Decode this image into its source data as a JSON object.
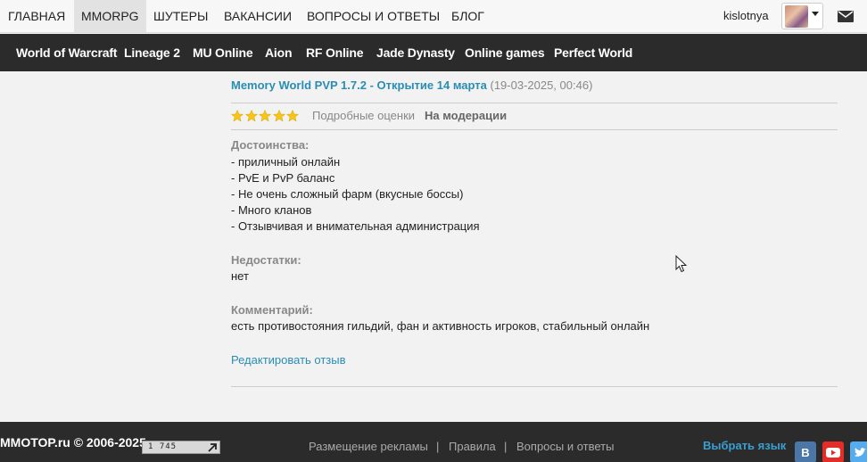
{
  "topnav": {
    "items": [
      "ГЛАВНАЯ",
      "MMORPG",
      "ШУТЕРЫ",
      "ВАКАНСИИ",
      "ВОПРОСЫ И ОТВЕТЫ",
      "БЛОГ"
    ],
    "active_index": 1,
    "username": "kislotnya",
    "avatar_icon": "user-avatar",
    "mail_icon": "envelope-icon"
  },
  "subnav": {
    "items": [
      "World of Warcraft",
      "Lineage 2",
      "MU Online",
      "Aion",
      "RF Online",
      "Jade Dynasty",
      "Online games",
      "Perfect World"
    ]
  },
  "review": {
    "title": "Memory World PVP 1.7.2 - Открытие 14 марта",
    "date": "(19-03-2025, 00:46)",
    "rating": 5,
    "rating_max": 5,
    "star_color": "#f5c518",
    "detailed_label": "Подробные оценки",
    "status_label": "На модерации",
    "pros_label": "Достоинства:",
    "pros": [
      "- приличный онлайн",
      "- PvE и PvP баланс",
      "- Не очень сложный фарм (вкусные боссы)",
      "- Много кланов",
      "- Отзывчивая и внимательная администрация"
    ],
    "cons_label": "Недостатки:",
    "cons": [
      "нет"
    ],
    "comment_label": "Комментарий:",
    "comment": [
      "есть противостояния гильдий, фан и активность игроков, стабильный онлайн"
    ],
    "edit_label": "Редактировать отзыв"
  },
  "footer": {
    "copyright": "MMOTOP.ru © 2006-2025",
    "counter_value": "1 745",
    "links": [
      "Размещение рекламы",
      "Правила",
      "Вопросы и ответы"
    ],
    "separator": "|",
    "language_link": "Выбрать язык",
    "social": [
      {
        "name": "vk-icon",
        "color": "#4a76a8"
      },
      {
        "name": "youtube-icon",
        "color": "#e52d27"
      },
      {
        "name": "twitter-icon",
        "color": "#55acee"
      }
    ]
  },
  "colors": {
    "accent_link": "#2a8db3",
    "dark_bar": "#2b2b2b"
  }
}
